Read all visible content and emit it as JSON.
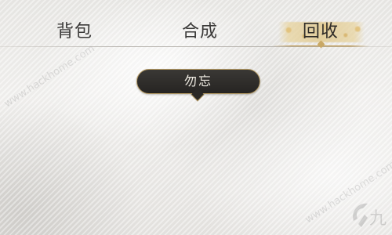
{
  "tabs": [
    {
      "label": "背包",
      "active": false
    },
    {
      "label": "合成",
      "active": false
    },
    {
      "label": "回收",
      "active": true
    }
  ],
  "tooltip": {
    "label": "勿忘"
  },
  "watermark": {
    "text_top": "www.hackhome.com",
    "text_bottom": "www.hackhome.com",
    "logo_text": "九"
  },
  "colors": {
    "accent_gold": "#c4a262",
    "tooltip_bg": "#2a2826",
    "text_dark": "#3b3a39"
  }
}
